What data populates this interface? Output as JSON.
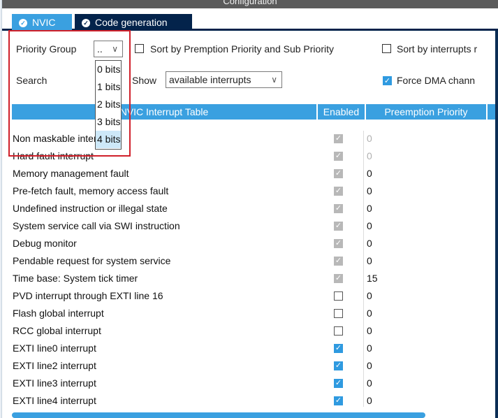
{
  "window": {
    "title": "Configuration"
  },
  "tabs": [
    {
      "label": "NVIC",
      "active": true
    },
    {
      "label": "Code generation",
      "active": false
    }
  ],
  "toolbar": {
    "priority_group_label": "Priority Group",
    "priority_group_value": "..",
    "sort_premption_label": "Sort by Premption Priority and Sub Priority",
    "sort_interrupts_label": "Sort by interrupts r",
    "search_label": "Search",
    "show_label": "Show",
    "show_value": "available interrupts",
    "force_dma_label": "Force DMA chann",
    "force_dma_checked": true
  },
  "priority_dropdown": {
    "options": [
      "0 bits",
      "1 bits",
      "2 bits",
      "3 bits",
      "4 bits"
    ],
    "selected_index": 4
  },
  "table": {
    "headers": {
      "name": "NVIC Interrupt Table",
      "enabled": "Enabled",
      "preemption": "Preemption Priority"
    },
    "rows": [
      {
        "name": "Non maskable interrupt",
        "enabled": "grey",
        "priority": "0",
        "dim": true
      },
      {
        "name": "Hard fault interrupt",
        "enabled": "grey",
        "priority": "0",
        "dim": true
      },
      {
        "name": "Memory management fault",
        "enabled": "grey",
        "priority": "0",
        "dim": false
      },
      {
        "name": "Pre-fetch fault, memory access fault",
        "enabled": "grey",
        "priority": "0",
        "dim": false
      },
      {
        "name": "Undefined instruction or illegal state",
        "enabled": "grey",
        "priority": "0",
        "dim": false
      },
      {
        "name": "System service call via SWI instruction",
        "enabled": "grey",
        "priority": "0",
        "dim": false
      },
      {
        "name": "Debug monitor",
        "enabled": "grey",
        "priority": "0",
        "dim": false
      },
      {
        "name": "Pendable request for system service",
        "enabled": "grey",
        "priority": "0",
        "dim": false
      },
      {
        "name": "Time base: System tick timer",
        "enabled": "grey",
        "priority": "15",
        "dim": false
      },
      {
        "name": "PVD interrupt through EXTI line 16",
        "enabled": "off",
        "priority": "0",
        "dim": false
      },
      {
        "name": "Flash global interrupt",
        "enabled": "off",
        "priority": "0",
        "dim": false
      },
      {
        "name": "RCC global interrupt",
        "enabled": "off",
        "priority": "0",
        "dim": false
      },
      {
        "name": "EXTI line0 interrupt",
        "enabled": "blue",
        "priority": "0",
        "dim": false
      },
      {
        "name": "EXTI line2 interrupt",
        "enabled": "blue",
        "priority": "0",
        "dim": false
      },
      {
        "name": "EXTI line3 interrupt",
        "enabled": "blue",
        "priority": "0",
        "dim": false
      },
      {
        "name": "EXTI line4 interrupt",
        "enabled": "blue",
        "priority": "0",
        "dim": false
      }
    ]
  },
  "colors": {
    "accent": "#3aa0e0",
    "dark_tab": "#03234b",
    "highlight": "#d0202a"
  }
}
